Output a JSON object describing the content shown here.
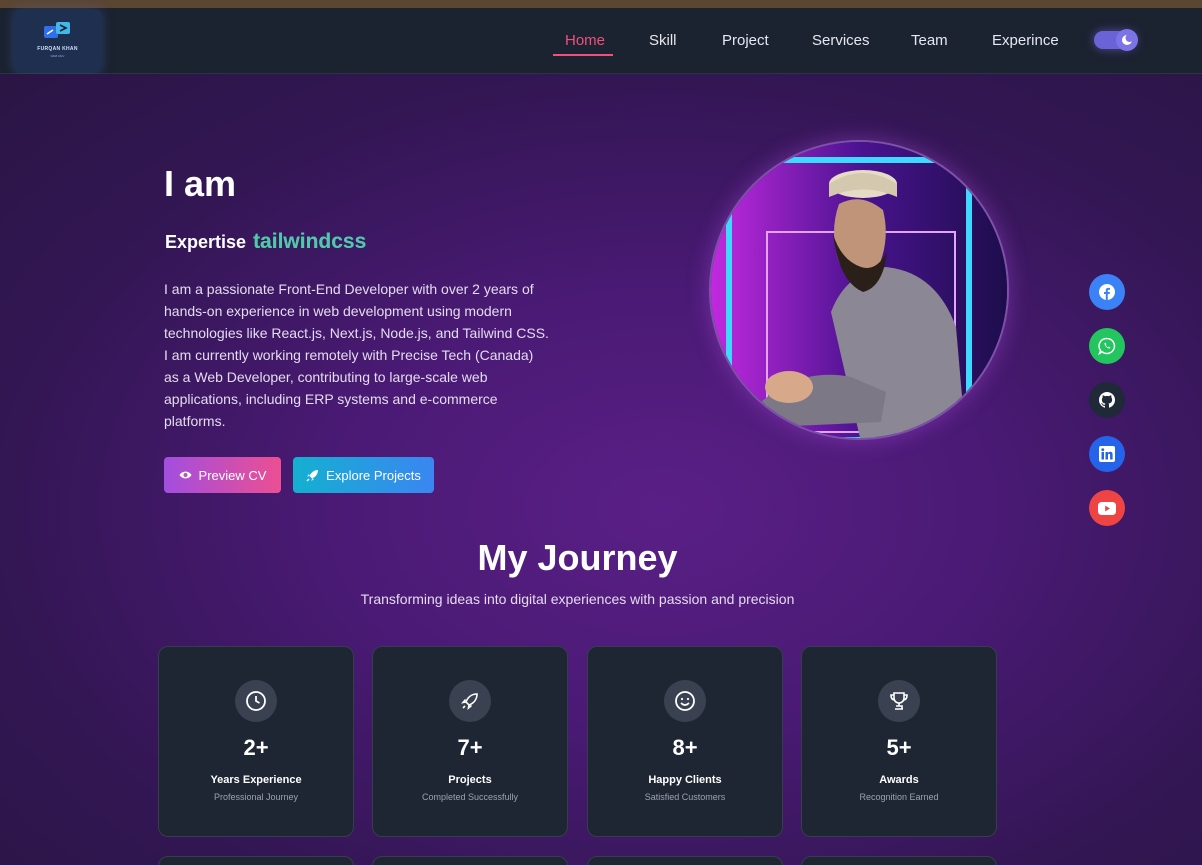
{
  "logo": {
    "name": "FURQAN KHAN",
    "tagline": "WEB DEV"
  },
  "nav": {
    "items": [
      "Home",
      "Skill",
      "Project",
      "Services",
      "Team",
      "Experince"
    ],
    "active": "Home"
  },
  "hero": {
    "greeting": "I am",
    "expertise_label": "Expertise",
    "expertise_value": "tailwindcss",
    "description": "I am a passionate Front-End Developer with over 2 years of hands-on experience in web development using modern technologies like React.js, Next.js, Node.js, and Tailwind CSS. I am currently working remotely with Precise Tech (Canada) as a Web Developer, contributing to large-scale web applications, including ERP systems and e-commerce platforms.",
    "buttons": {
      "preview_cv": "Preview CV",
      "explore_projects": "Explore Projects"
    }
  },
  "social": [
    "facebook-icon",
    "whatsapp-icon",
    "github-icon",
    "linkedin-icon",
    "youtube-icon"
  ],
  "journey": {
    "title": "My Journey",
    "subtitle": "Transforming ideas into digital experiences with passion and precision",
    "cards": [
      {
        "icon": "clock-icon",
        "value": "2+",
        "label": "Years Experience",
        "sub": "Professional Journey"
      },
      {
        "icon": "rocket-icon",
        "value": "7+",
        "label": "Projects",
        "sub": "Completed Successfully"
      },
      {
        "icon": "smile-icon",
        "value": "8+",
        "label": "Happy Clients",
        "sub": "Satisfied Customers"
      },
      {
        "icon": "trophy-icon",
        "value": "5+",
        "label": "Awards",
        "sub": "Recognition Earned"
      }
    ]
  },
  "colors": {
    "accent": "#f0507e",
    "navbar": "#1b2230",
    "card": "#1f2633",
    "facebook": "#3b82f6",
    "whatsapp": "#22c55e",
    "github": "#1f2937",
    "linkedin": "#2563eb",
    "youtube": "#ef4444"
  }
}
